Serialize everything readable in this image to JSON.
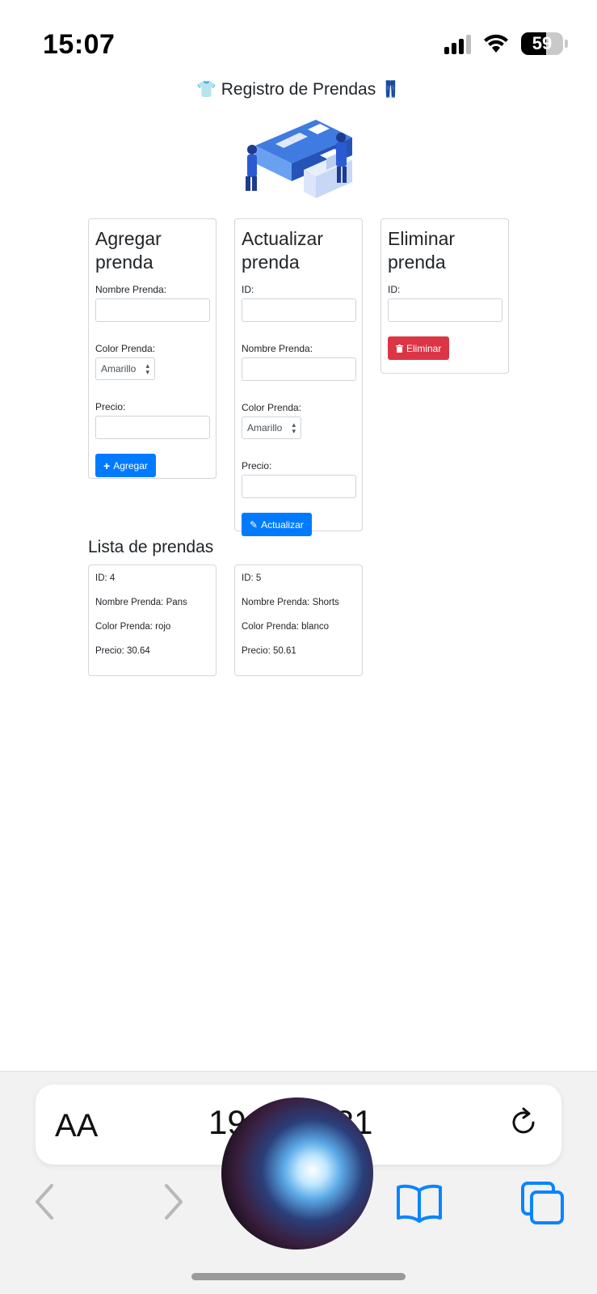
{
  "status_bar": {
    "time": "15:07",
    "battery": "59"
  },
  "page": {
    "title": "Registro de Prendas",
    "title_left_emoji": "👕",
    "title_right_emoji": "👖"
  },
  "add_card": {
    "title": "Agregar prenda",
    "name_label": "Nombre Prenda:",
    "color_label": "Color Prenda:",
    "color_value": "Amarillo",
    "price_label": "Precio:",
    "button_label": "Agregar",
    "button_icon": "plus-icon"
  },
  "update_card": {
    "title": "Actualizar prenda",
    "id_label": "ID:",
    "name_label": "Nombre Prenda:",
    "color_label": "Color Prenda:",
    "color_value": "Amarillo",
    "price_label": "Precio:",
    "button_label": "Actualizar",
    "button_icon": "pencil-icon"
  },
  "delete_card": {
    "title": "Eliminar prenda",
    "id_label": "ID:",
    "button_label": "Eliminar",
    "button_icon": "trash-icon"
  },
  "list": {
    "title": "Lista de prendas",
    "items": [
      {
        "id": "ID: 4",
        "name": "Nombre Prenda: Pans",
        "color": "Color Prenda: rojo",
        "price": "Precio: 30.64"
      },
      {
        "id": "ID: 5",
        "name": "Nombre Prenda: Shorts",
        "color": "Color Prenda: blanco",
        "price": "Precio: 50.61"
      }
    ]
  },
  "browser": {
    "text_size_label": "AA",
    "url_left": "19",
    "url_right": "81"
  },
  "colors": {
    "primary": "#007bff",
    "danger": "#dc3545",
    "card_border": "#d6d6d6",
    "ios_blue": "#0a84ff"
  }
}
